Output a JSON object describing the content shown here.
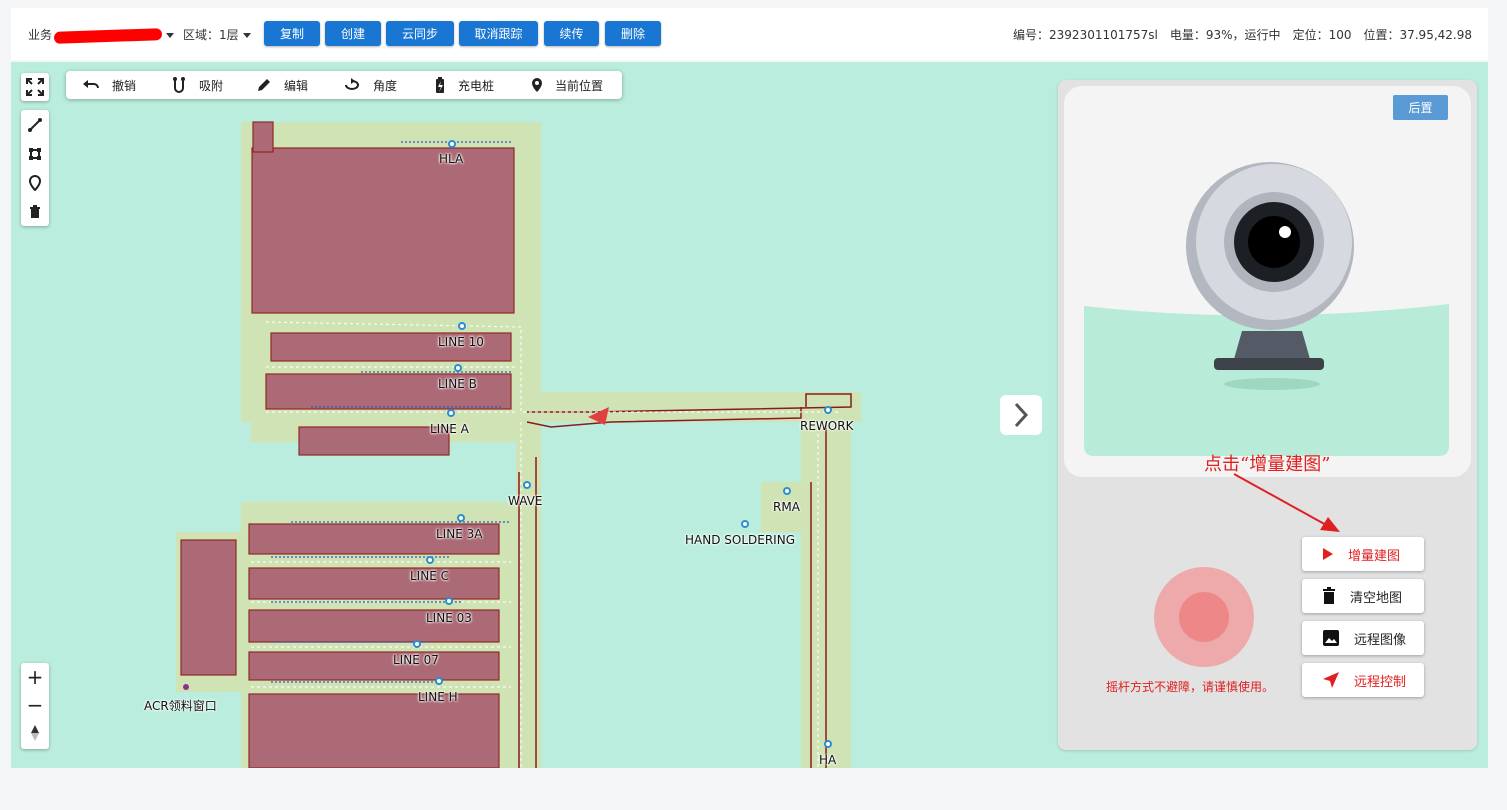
{
  "header": {
    "biz_label": "业务",
    "region_label": "区域：1层",
    "buttons": [
      "复制",
      "创建",
      "云同步",
      "取消跟踪",
      "续传",
      "删除"
    ],
    "status": {
      "serial": "编号：2392301101757sl",
      "battery": "电量：93%，运行中",
      "locate": "定位：100",
      "position": "位置：37.95,42.98"
    }
  },
  "map_toolbar": {
    "undo": "撤销",
    "snap": "吸附",
    "edit": "编辑",
    "angle": "角度",
    "charger": "充电桩",
    "current_position": "当前位置"
  },
  "map_labels": {
    "hla": "HLA",
    "line10": "LINE 10",
    "lineb": "LINE B",
    "linea": "LINE A",
    "rework": "REWORK",
    "wave": "WAVE",
    "rma": "RMA",
    "hand_soldering": "HAND SOLDERING",
    "line3a": "LINE 3A",
    "linec": "LINE C",
    "line03": "LINE 03",
    "line07": "LINE 07",
    "lineh": "LINE H",
    "acr": "ACR领料窗口",
    "ha": "HA"
  },
  "panel": {
    "reset": "后置",
    "hint": "点击“增量建图”",
    "actions": {
      "incremental": "增量建图",
      "clear": "清空地图",
      "remote_image": "远程图像",
      "remote_control": "远程控制"
    },
    "warning": "摇杆方式不避障，请谨慎使用。"
  },
  "colors": {
    "accent": "#1976d2",
    "map_bg": "#baeddd",
    "obstacle": "#a86070",
    "danger": "#e02020"
  }
}
